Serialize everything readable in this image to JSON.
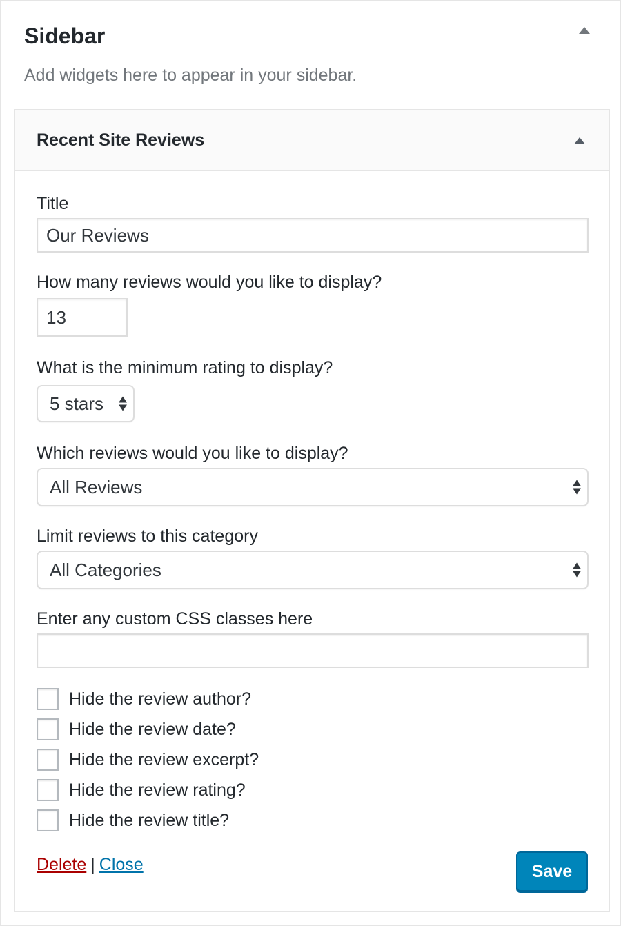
{
  "sidebar": {
    "title": "Sidebar",
    "description": "Add widgets here to appear in your sidebar."
  },
  "widget": {
    "title": "Recent Site Reviews",
    "fields": {
      "title_label": "Title",
      "title_value": "Our Reviews",
      "count_label": "How many reviews would you like to display?",
      "count_value": "13",
      "rating_label": "What is the minimum rating to display?",
      "rating_value": "5 stars",
      "display_label": "Which reviews would you like to display?",
      "display_value": "All Reviews",
      "category_label": "Limit reviews to this category",
      "category_value": "All Categories",
      "css_label": "Enter any custom CSS classes here",
      "css_value": ""
    },
    "checkboxes": [
      {
        "label": "Hide the review author?",
        "checked": false
      },
      {
        "label": "Hide the review date?",
        "checked": false
      },
      {
        "label": "Hide the review excerpt?",
        "checked": false
      },
      {
        "label": "Hide the review rating?",
        "checked": false
      },
      {
        "label": "Hide the review title?",
        "checked": false
      }
    ],
    "actions": {
      "delete_label": "Delete",
      "separator": "|",
      "close_label": "Close",
      "save_label": "Save"
    }
  },
  "colors": {
    "link_delete": "#aa0000",
    "link_close": "#0073aa",
    "primary_button": "#0085ba"
  }
}
